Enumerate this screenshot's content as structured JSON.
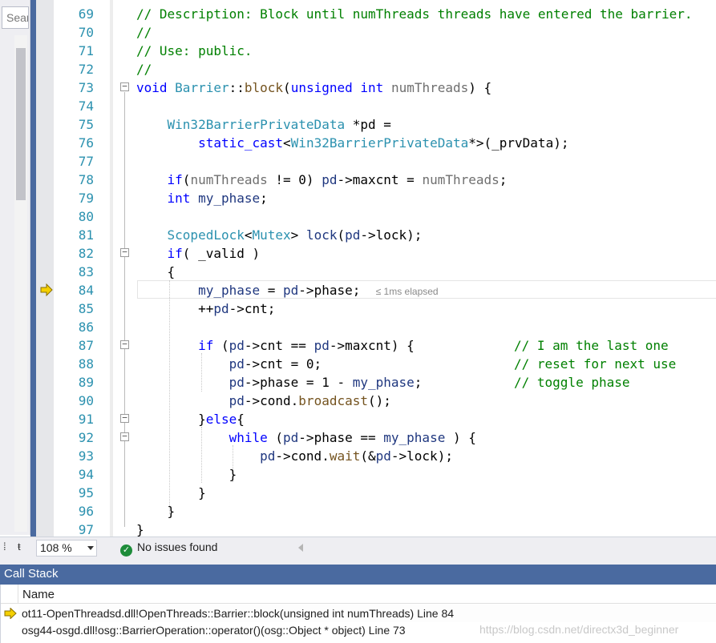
{
  "left_panel": {
    "search_placeholder": "Sear"
  },
  "editor": {
    "lines": [
      {
        "n": "69"
      },
      {
        "n": "70"
      },
      {
        "n": "71"
      },
      {
        "n": "72"
      },
      {
        "n": "73"
      },
      {
        "n": "74"
      },
      {
        "n": "75"
      },
      {
        "n": "76"
      },
      {
        "n": "77"
      },
      {
        "n": "78"
      },
      {
        "n": "79"
      },
      {
        "n": "80"
      },
      {
        "n": "81"
      },
      {
        "n": "82"
      },
      {
        "n": "83"
      },
      {
        "n": "84"
      },
      {
        "n": "85"
      },
      {
        "n": "86"
      },
      {
        "n": "87"
      },
      {
        "n": "88"
      },
      {
        "n": "89"
      },
      {
        "n": "90"
      },
      {
        "n": "91"
      },
      {
        "n": "92"
      },
      {
        "n": "93"
      },
      {
        "n": "94"
      },
      {
        "n": "95"
      },
      {
        "n": "96"
      },
      {
        "n": "97"
      }
    ],
    "code": {
      "l69": "// Description: Block until numThreads threads have entered the barrier.",
      "l70": "//",
      "l71": "// Use: public.",
      "l72": "//",
      "l73_void": "void",
      "l73_class": "Barrier",
      "l73_scope": "::",
      "l73_fn": "block",
      "l73_open": "(",
      "l73_unsigned": "unsigned",
      "l73_int": "int",
      "l73_param": "numThreads",
      "l73_close": ") {",
      "l75_type": "Win32BarrierPrivateData",
      "l75_rest": " *pd =",
      "l76_cast": "static_cast",
      "l76_lt": "<",
      "l76_type": "Win32BarrierPrivateData",
      "l76_rest": "*>(_prvData);",
      "l78_if": "if",
      "l78_a": "(",
      "l78_param": "numThreads",
      "l78_b": " != 0) ",
      "l78_pd": "pd",
      "l78_c": "->maxcnt = ",
      "l78_param2": "numThreads",
      "l78_d": ";",
      "l79_int": "int",
      "l79_var": " my_phase",
      "l79_semi": ";",
      "l81_type": "ScopedLock",
      "l81_lt": "<",
      "l81_mutex": "Mutex",
      "l81_gt": "> ",
      "l81_lock": "lock",
      "l81_a": "(",
      "l81_pd": "pd",
      "l81_b": "->lock);",
      "l82_if": "if",
      "l82_rest": "( _valid )",
      "l83": "{",
      "l84_var": "my_phase",
      "l84_a": " = ",
      "l84_pd": "pd",
      "l84_b": "->phase;",
      "l84_tip": "≤ 1ms elapsed",
      "l85_a": "++",
      "l85_pd": "pd",
      "l85_b": "->cnt;",
      "l87_if": "if",
      "l87_a": " (",
      "l87_pd": "pd",
      "l87_b": "->cnt == ",
      "l87_pd2": "pd",
      "l87_c": "->maxcnt) {",
      "l87_cm": "// I am the last one",
      "l88_pd": "pd",
      "l88_a": "->cnt = 0;",
      "l88_cm": "// reset for next use",
      "l89_pd": "pd",
      "l89_a": "->phase = 1 - ",
      "l89_var": "my_phase",
      "l89_b": ";",
      "l89_cm": "// toggle phase",
      "l90_pd": "pd",
      "l90_a": "->cond.",
      "l90_fn": "broadcast",
      "l90_b": "();",
      "l91_a": "}",
      "l91_else": "else",
      "l91_b": "{",
      "l92_while": "while",
      "l92_a": " (",
      "l92_pd": "pd",
      "l92_b": "->phase == ",
      "l92_var": "my_phase",
      "l92_c": " ) {",
      "l93_pd": "pd",
      "l93_a": "->cond.",
      "l93_fn": "wait",
      "l93_b": "(&",
      "l93_pd2": "pd",
      "l93_c": "->lock);",
      "l94": "}",
      "l95": "}",
      "l96": "}",
      "l97": "}"
    }
  },
  "status_bar": {
    "zoom": "108 %",
    "issues": "No issues found"
  },
  "call_stack": {
    "title": "Call Stack",
    "column_name": "Name",
    "rows": [
      "ot11-OpenThreadsd.dll!OpenThreads::Barrier::block(unsigned int numThreads) Line 84",
      "osg44-osgd.dll!osg::BarrierOperation::operator()(osg::Object * object) Line 73"
    ]
  },
  "watermark": "https://blog.csdn.net/directx3d_beginner",
  "colors": {
    "comment": "#008000",
    "keyword": "#0000ff",
    "type": "#2b91af",
    "line_number": "#2b91af",
    "panel_title_bg": "#4a6aa0",
    "exec_arrow": "#f5d000"
  }
}
